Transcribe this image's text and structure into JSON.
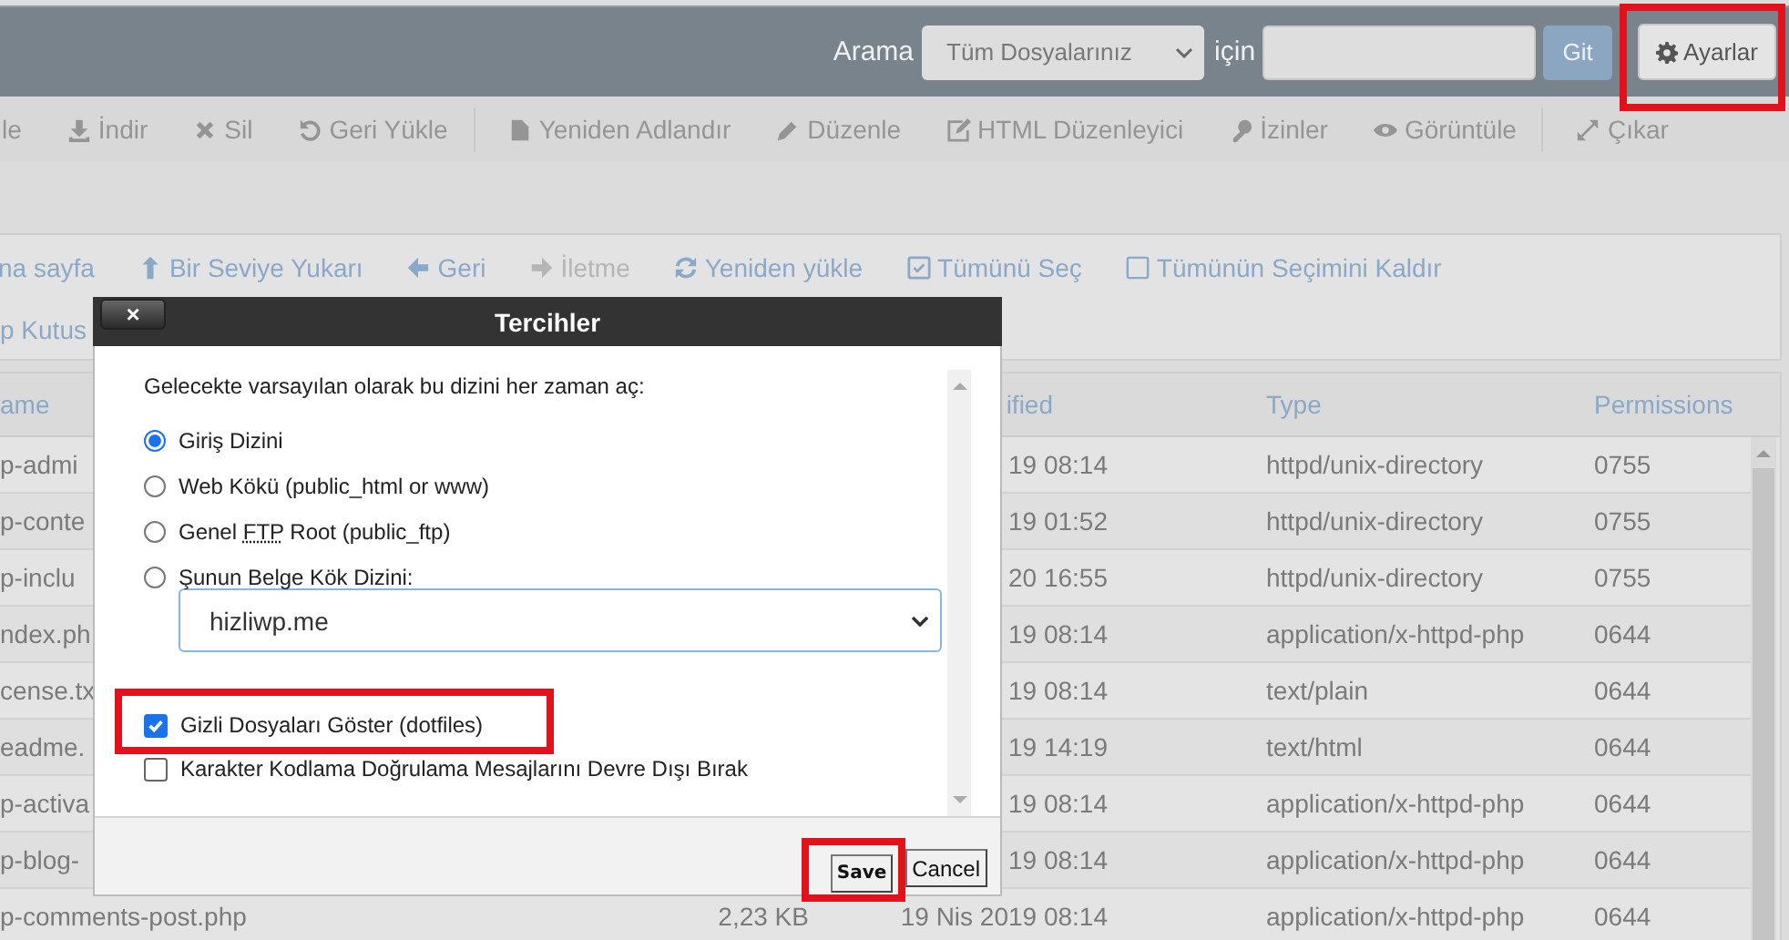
{
  "topbar": {
    "search_label": "Arama",
    "scope": "Tüm Dosyalarınız",
    "for_label": "için",
    "go": "Git",
    "settings": "Ayarlar"
  },
  "toolbar": {
    "groups": [
      [
        {
          "label": "le",
          "disabled": true
        },
        {
          "label": "İndir",
          "disabled": true
        },
        {
          "label": "Sil",
          "disabled": true
        },
        {
          "label": "Geri Yükle",
          "disabled": true
        }
      ],
      [
        {
          "label": "Yeniden Adlandır",
          "disabled": true
        },
        {
          "label": "Düzenle",
          "disabled": true
        },
        {
          "label": "HTML Düzenleyici",
          "disabled": true
        },
        {
          "label": "İzinler",
          "disabled": true
        },
        {
          "label": "Görüntüle",
          "disabled": true
        }
      ],
      [
        {
          "label": "Çıkar",
          "disabled": true
        }
      ]
    ]
  },
  "nav": {
    "items": [
      {
        "label": "na sayfa",
        "disabled": false
      },
      {
        "label": "Bir Seviye Yukarı",
        "disabled": false
      },
      {
        "label": "Geri",
        "disabled": false
      },
      {
        "label": "İletme",
        "disabled": true
      },
      {
        "label": "Yeniden yükle",
        "disabled": false
      },
      {
        "label": "Tümünü Seç",
        "disabled": false
      },
      {
        "label": "Tümünün Seçimini Kaldır",
        "disabled": false
      }
    ],
    "second_line": "p Kutus"
  },
  "table": {
    "columns": [
      "ame",
      "",
      "ified",
      "Type",
      "Permissions"
    ],
    "rows": [
      [
        "p-admi",
        "",
        "19 08:14",
        "httpd/unix-directory",
        "0755"
      ],
      [
        "p-conte",
        "",
        "19 01:52",
        "httpd/unix-directory",
        "0755"
      ],
      [
        "p-inclu",
        "",
        "20 16:55",
        "httpd/unix-directory",
        "0755"
      ],
      [
        "ndex.ph",
        "",
        "19 08:14",
        "application/x-httpd-php",
        "0644"
      ],
      [
        "cense.tx",
        "",
        "19 08:14",
        "text/plain",
        "0644"
      ],
      [
        "eadme.",
        "",
        "19 14:19",
        "text/html",
        "0644"
      ],
      [
        "p-activa",
        "",
        "19 08:14",
        "application/x-httpd-php",
        "0644"
      ],
      [
        "p-blog-",
        "",
        "19 08:14",
        "application/x-httpd-php",
        "0644"
      ],
      [
        "p-comments-post.php",
        "2,23 KB",
        "19 Nis 2019 08:14",
        "application/x-httpd-php",
        "0644"
      ]
    ]
  },
  "dialog": {
    "title": "Tercihler",
    "close": "×",
    "intro": "Gelecekte varsayılan olarak bu dizini her zaman aç:",
    "options": [
      {
        "kind": "radio",
        "label": "Giriş Dizini",
        "selected": true
      },
      {
        "kind": "radio",
        "label": "Web Kökü (public_html or www)",
        "selected": false
      },
      {
        "kind": "radio",
        "before": "Genel ",
        "abbr": "FTP",
        "label": " Root (public_ftp)",
        "selected": false
      },
      {
        "kind": "radio",
        "label": "Şunun Belge Kök Dizini:",
        "selected": false,
        "select": "hizliwp.me"
      },
      {
        "kind": "checkbox",
        "label": "Gizli Dosyaları Göster (dotfiles)",
        "checked": true
      },
      {
        "kind": "checkbox",
        "label": "Karakter Kodlama Doğrulama Mesajlarını Devre Dışı Bırak",
        "checked": false
      }
    ],
    "buttons": [
      "Save",
      "Cancel"
    ]
  }
}
